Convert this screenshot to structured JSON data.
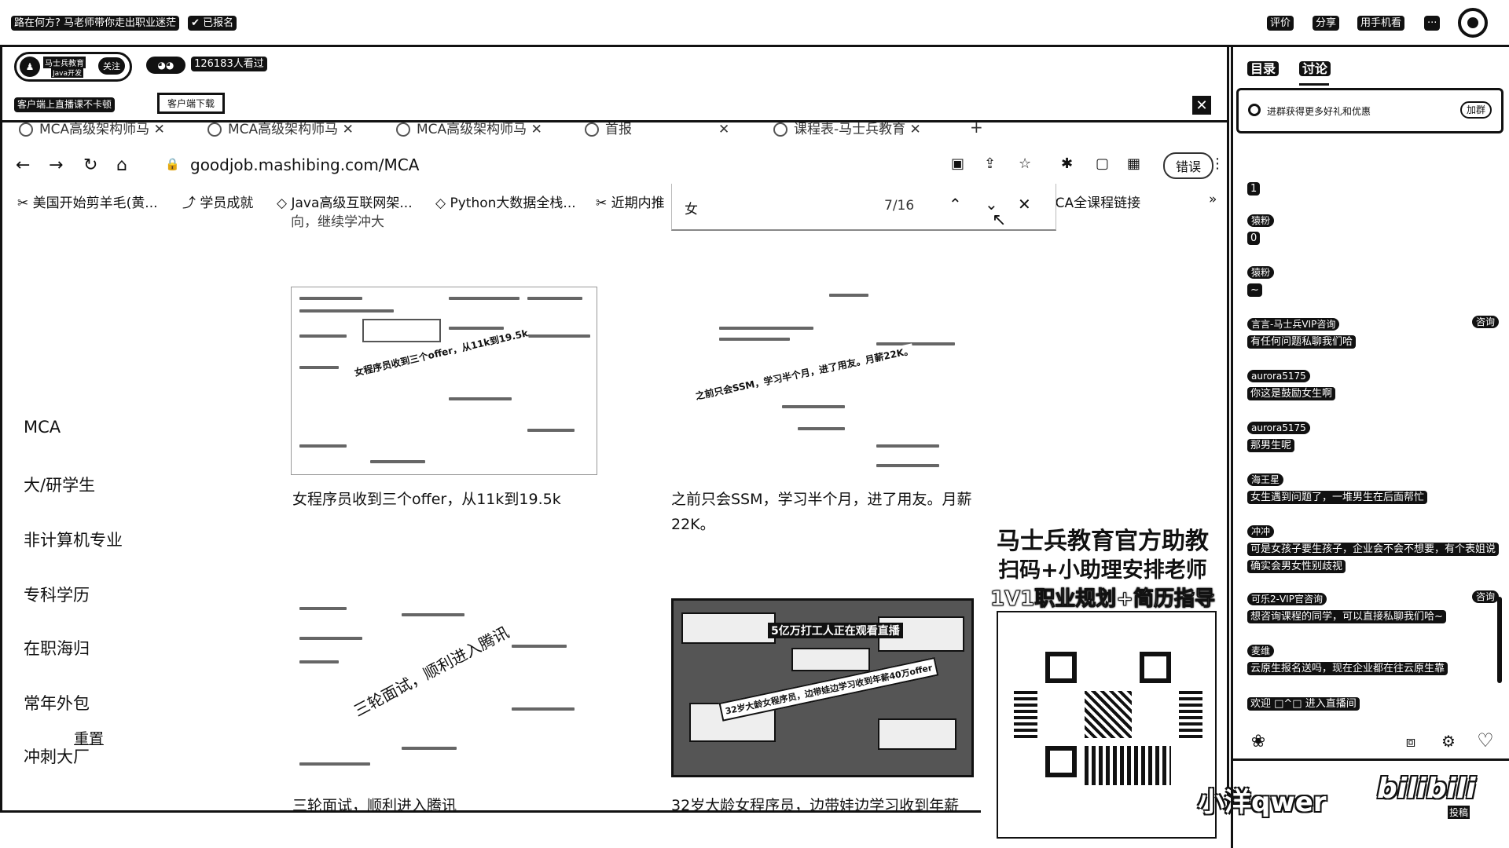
{
  "topbar": {
    "title": "路在何方? 马老师带你走出职业迷茫",
    "registered": "已报名",
    "rate": "评价",
    "share": "分享",
    "phone": "用手机看",
    "more": "···"
  },
  "live": {
    "brand": "马士兵教育",
    "brand_sub": "Java开发",
    "follow": "关注",
    "viewers": "126183人看过",
    "client_tip": "客户端上直播课不卡顿",
    "download": "客户端下载"
  },
  "chat": {
    "tab_catalog": "目录",
    "tab_discuss": "讨论",
    "promo": "进群获得更多好礼和优惠",
    "promo_btn": "加群",
    "messages": [
      {
        "user": "",
        "text": "1"
      },
      {
        "user": "猿粉",
        "text": "0"
      },
      {
        "user": "猿粉",
        "text": "~"
      },
      {
        "user": "言言-马士兵VIP咨询",
        "badge": "咨询",
        "text": "有任何问题私聊我们哈"
      },
      {
        "user": "aurora5175",
        "text": "你这是鼓励女生啊"
      },
      {
        "user": "aurora5175",
        "text": "那男生呢"
      },
      {
        "user": "海王星",
        "text": "女生遇到问题了，一堆男生在后面帮忙"
      },
      {
        "user": "冲冲",
        "text": "可是女孩子要生孩子，企业会不会不想要，有个表姐说确实会男女性别歧视"
      },
      {
        "user": "可乐2-VIP官咨询",
        "badge": "咨询",
        "text": "想咨询课程的同学，可以直接私聊我们哈~"
      },
      {
        "user": "麦维",
        "text": "云原生报名送吗，现在企业都在往云原生靠"
      }
    ],
    "welcome": "欢迎 □^□ 进入直播间"
  },
  "browser": {
    "tabs": [
      "MCA高级架构师马",
      "MCA高级架构师马",
      "MCA高级架构师马",
      "首报",
      "课程表-马士兵教育"
    ],
    "url": "goodjob.mashibing.com/MCA",
    "error_btn": "错误",
    "bookmarks": [
      "美国开始剪羊毛(黄...",
      "学员成就",
      "Java高级互联网架...",
      "Python大数据全栈...",
      "近期内推",
      "MCA全课程链接"
    ],
    "find": {
      "query": "女",
      "count": "7/16"
    },
    "partial_top": "向，继续学冲大",
    "categories": [
      "MCA",
      "大/研学生",
      "非计算机专业",
      "专科学历",
      "在职海归",
      "常年外包",
      "冲刺大厂"
    ],
    "reset": "重置",
    "cards": [
      {
        "banner": "女程序员收到三个offer，从11k到19.5k",
        "caption": "女程序员收到三个offer，从11k到19.5k"
      },
      {
        "banner": "之前只会SSM，学习半个月，进了用友。月薪22K。",
        "caption": "之前只会SSM，学习半个月，进了用友。月薪22K。"
      },
      {
        "banner": "三轮面试，顺利进入腾讯",
        "caption": "三轮面试，顺利进入腾讯"
      },
      {
        "banner": "32岁大龄女程序员，边带娃边学习收到年薪40万offer",
        "top_banner": "5亿万打工人正在观看直播",
        "caption": "32岁大龄女程序员，边带娃边学习收到年薪"
      }
    ]
  },
  "qr": {
    "line1": "马士兵教育官方助教",
    "line2": "扫码+小助理安排老师",
    "line3": "1V1职业规划+简历指导"
  },
  "watermark": {
    "user": "小洋qwer",
    "site": "bilibili",
    "tag": "投稿"
  }
}
